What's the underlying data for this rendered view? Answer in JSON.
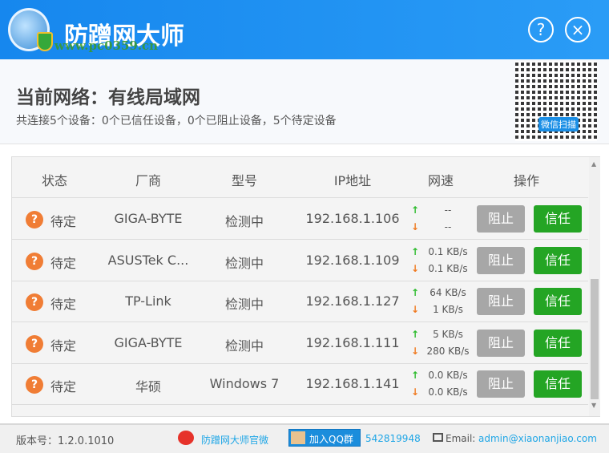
{
  "app": {
    "title": "防蹭网大师",
    "watermark": "www.pc0359.cn",
    "help_icon": "?",
    "close_icon": "×"
  },
  "info": {
    "network": "当前网络：有线局域网",
    "summary": "共连接5个设备：0个已信任设备，0个已阻止设备，5个待定设备",
    "qr_label": "微信扫描"
  },
  "table": {
    "headers": [
      "状态",
      "厂商",
      "型号",
      "IP地址",
      "网速",
      "操作"
    ],
    "rows": [
      {
        "status": "待定",
        "vendor": "GIGA-BYTE",
        "model": "检测中",
        "ip": "192.168.1.106",
        "up": "--",
        "down": "--"
      },
      {
        "status": "待定",
        "vendor": "ASUSTek C...",
        "model": "检测中",
        "ip": "192.168.1.109",
        "up": "0.1 KB/s",
        "down": "0.1 KB/s"
      },
      {
        "status": "待定",
        "vendor": "TP-Link",
        "model": "检测中",
        "ip": "192.168.1.127",
        "up": "64 KB/s",
        "down": "1 KB/s"
      },
      {
        "status": "待定",
        "vendor": "GIGA-BYTE",
        "model": "检测中",
        "ip": "192.168.1.111",
        "up": "5 KB/s",
        "down": "280 KB/s"
      },
      {
        "status": "待定",
        "vendor": "华硕",
        "model": "Windows 7",
        "ip": "192.168.1.141",
        "up": "0.0 KB/s",
        "down": "0.0 KB/s"
      }
    ],
    "block_label": "阻止",
    "trust_label": "信任"
  },
  "footer": {
    "version": "版本号：1.2.0.1010",
    "weibo": "防蹭网大师官微",
    "qq_button": "加入QQ群",
    "qq_number": "542819948",
    "email_label": "Email:",
    "email": "admin@xiaonanjiao.com"
  }
}
